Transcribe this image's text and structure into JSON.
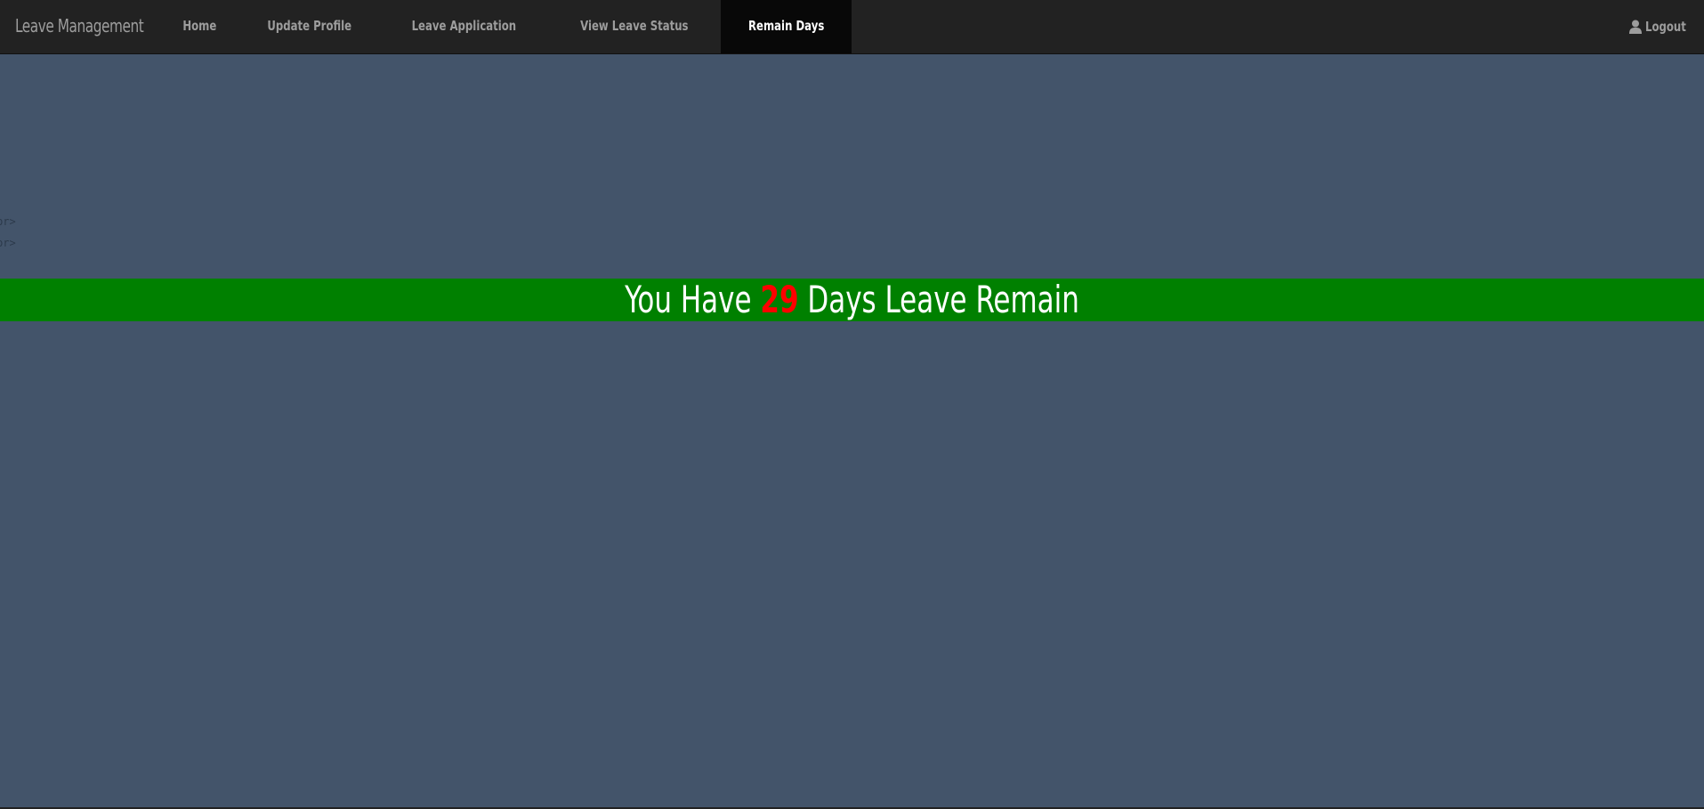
{
  "navbar": {
    "brand": "Leave Management",
    "items": [
      {
        "label": "Home",
        "active": false
      },
      {
        "label": "Update Profile",
        "active": false
      },
      {
        "label": "Leave Application",
        "active": false
      },
      {
        "label": "View Leave Status",
        "active": false
      },
      {
        "label": "Remain Days",
        "active": true
      }
    ],
    "logout_label": "Logout",
    "logout_icon": "user-icon"
  },
  "stray_text": [
    "br>",
    "br>"
  ],
  "banner": {
    "prefix": "You Have",
    "days": "29",
    "suffix": "Days Leave Remain"
  },
  "colors": {
    "background": "#43546a",
    "navbar": "#222222",
    "banner": "#008000",
    "days_highlight": "#ff0000"
  }
}
